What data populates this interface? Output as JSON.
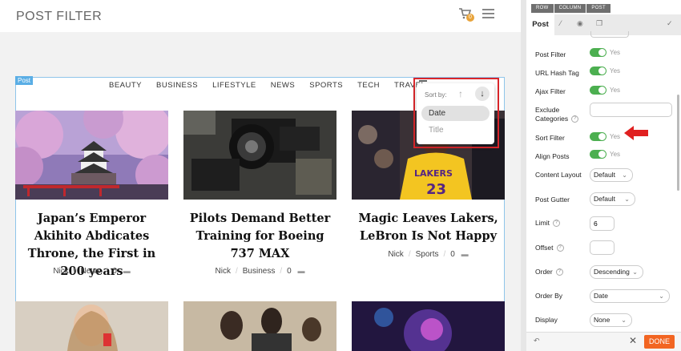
{
  "site": {
    "title": "POST FILTER",
    "cart_count": "0"
  },
  "post_tag": "Post",
  "filters": [
    "BEAUTY",
    "BUSINESS",
    "LIFESTYLE",
    "NEWS",
    "SPORTS",
    "TECH",
    "TRAVEL"
  ],
  "sort": {
    "label": "Sort by:",
    "options": [
      "Date",
      "Title"
    ],
    "selected": "Date"
  },
  "cards": [
    {
      "title": "Japan’s Emperor Akihito Abdicates Throne, the First in 200 years",
      "author": "Nick",
      "category": "News",
      "comments": "0"
    },
    {
      "title": "Pilots Demand Better Training for Boeing 737 MAX",
      "author": "Nick",
      "category": "Business",
      "comments": "0"
    },
    {
      "title": "Magic Leaves Lakers, LeBron Is Not Happy",
      "author": "Nick",
      "category": "Sports",
      "comments": "0"
    }
  ],
  "panel": {
    "breadcrumb": [
      "ROW",
      "COLUMN",
      "POST"
    ],
    "tab_active": "Post",
    "yes": "Yes",
    "fields": {
      "post_filter": "Post Filter",
      "url_hash": "URL Hash Tag",
      "ajax": "Ajax Filter",
      "exclude": "Exclude",
      "categories": "Categories",
      "sort_filter": "Sort Filter",
      "align_posts": "Align Posts",
      "content_layout": "Content Layout",
      "post_gutter": "Post Gutter",
      "limit": "Limit",
      "offset": "Offset",
      "order": "Order",
      "order_by": "Order By",
      "display": "Display"
    },
    "values": {
      "content_layout": "Default",
      "post_gutter": "Default",
      "limit": "6",
      "offset": "",
      "order": "Descending",
      "order_by": "Date",
      "display": "None"
    },
    "done": "DONE"
  },
  "colors": {
    "accent": "#f26522",
    "toggle": "#4caf50",
    "highlight": "#d9262b",
    "post_border": "#8fc5ea"
  }
}
